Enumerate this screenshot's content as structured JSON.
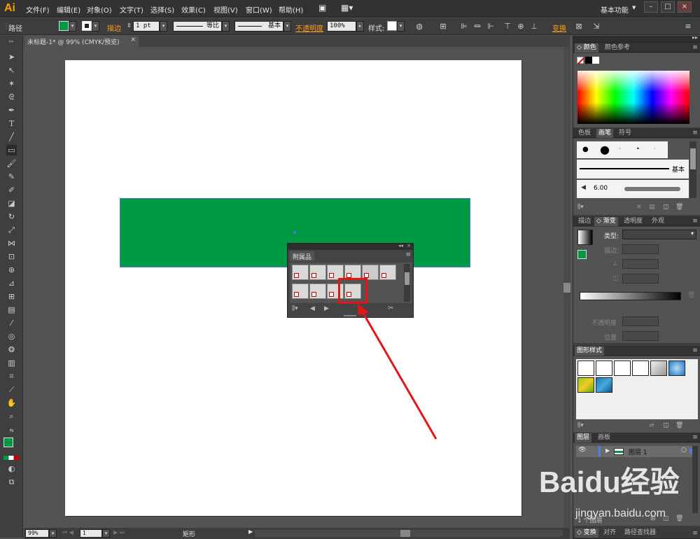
{
  "app": {
    "logo": "Ai",
    "workspace": "基本功能"
  },
  "menu": [
    "文件(F)",
    "编辑(E)",
    "对象(O)",
    "文字(T)",
    "选择(S)",
    "效果(C)",
    "视图(V)",
    "窗口(W)",
    "帮助(H)"
  ],
  "control": {
    "selection": "路径",
    "stroke_label": "描边",
    "stroke_weight": "1 pt",
    "profile_label": "等比",
    "brush_label": "基本",
    "opacity_label": "不透明度",
    "opacity_value": "100%",
    "style_label": "样式:",
    "transform_label": "变换"
  },
  "doc_tab": {
    "title": "未标题-1* @ 99% (CMYK/预览)",
    "close": "×"
  },
  "float_panel": {
    "title": "附属品"
  },
  "status": {
    "zoom": "99%",
    "page": "1",
    "tool": "矩形"
  },
  "panels": {
    "color": {
      "tabs": [
        "颜色",
        "颜色参考"
      ]
    },
    "brushes": {
      "tabs": [
        "色板",
        "画笔",
        "符号"
      ],
      "basic_label": "基本",
      "size_label": "6.00"
    },
    "gradient": {
      "tabs": [
        "描边",
        "渐变",
        "透明度",
        "外观"
      ],
      "type_label": "类型:",
      "stroke_label": "描边:",
      "opacity_label": "不透明度",
      "position_label": "位置"
    },
    "graphic_styles": {
      "tabs": [
        "图形样式"
      ]
    },
    "layers": {
      "tabs": [
        "图层",
        "画板"
      ],
      "layer_name": "图层 1",
      "footer_label": "1 个图层"
    },
    "bottom": {
      "tabs": [
        "变换",
        "对齐",
        "路径查找器"
      ]
    }
  },
  "watermark": {
    "text": "Baidu经验",
    "sub": "jingyan.baidu.com"
  },
  "colors": {
    "fill": "#009944",
    "highlight": "#e41515",
    "accent": "#ff9a00"
  }
}
